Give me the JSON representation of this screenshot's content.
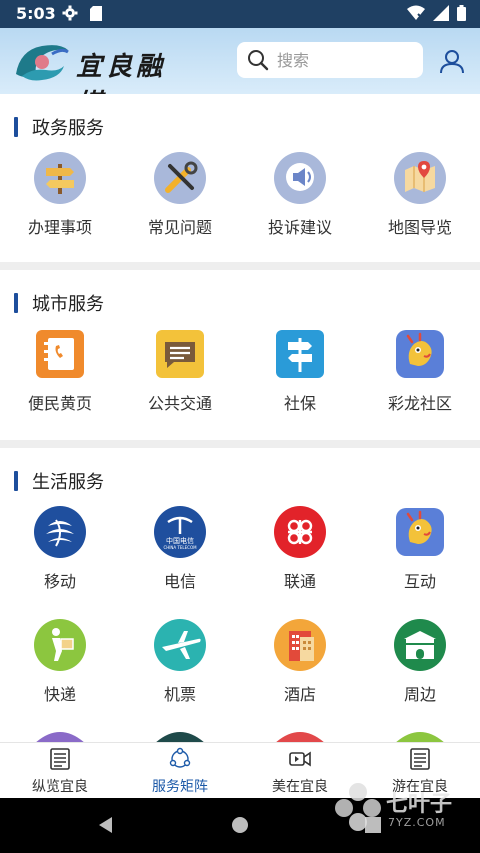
{
  "status_bar": {
    "time": "5:03"
  },
  "header": {
    "logo_text": "宜良融媒",
    "search_placeholder": "搜索"
  },
  "sections": [
    {
      "title": "政务服务",
      "items": [
        {
          "label": "办理事项",
          "icon": "signpost-icon"
        },
        {
          "label": "常见问题",
          "icon": "tools-icon"
        },
        {
          "label": "投诉建议",
          "icon": "megaphone-icon"
        },
        {
          "label": "地图导览",
          "icon": "map-icon"
        }
      ]
    },
    {
      "title": "城市服务",
      "items": [
        {
          "label": "便民黄页",
          "icon": "phonebook-icon"
        },
        {
          "label": "公共交通",
          "icon": "message-icon"
        },
        {
          "label": "社保",
          "icon": "direction-sign-icon"
        },
        {
          "label": "彩龙社区",
          "icon": "dragon-icon"
        }
      ]
    },
    {
      "title": "生活服务",
      "items": [
        {
          "label": "移动",
          "icon": "china-mobile-icon"
        },
        {
          "label": "电信",
          "icon": "china-telecom-icon"
        },
        {
          "label": "联通",
          "icon": "china-unicom-icon"
        },
        {
          "label": "互动",
          "icon": "dragon-icon"
        },
        {
          "label": "快递",
          "icon": "courier-icon"
        },
        {
          "label": "机票",
          "icon": "airplane-icon"
        },
        {
          "label": "酒店",
          "icon": "hotel-icon"
        },
        {
          "label": "周边",
          "icon": "gate-icon"
        }
      ]
    }
  ],
  "telecom_logo_text": {
    "cn": "中国电信",
    "en": "CHINA TELECOM"
  },
  "bottom_nav": [
    {
      "label": "纵览宜良",
      "icon": "newspaper-icon",
      "active": false
    },
    {
      "label": "服务矩阵",
      "icon": "hub-icon",
      "active": true
    },
    {
      "label": "美在宜良",
      "icon": "video-icon",
      "active": false
    },
    {
      "label": "游在宜良",
      "icon": "newspaper-icon",
      "active": false
    }
  ],
  "watermark": {
    "text": "七叶子",
    "sub": "7YZ.COM"
  },
  "colors": {
    "accent": "#1d4e9c",
    "status_bar": "#1f4063",
    "header": "#c8e2f6"
  }
}
